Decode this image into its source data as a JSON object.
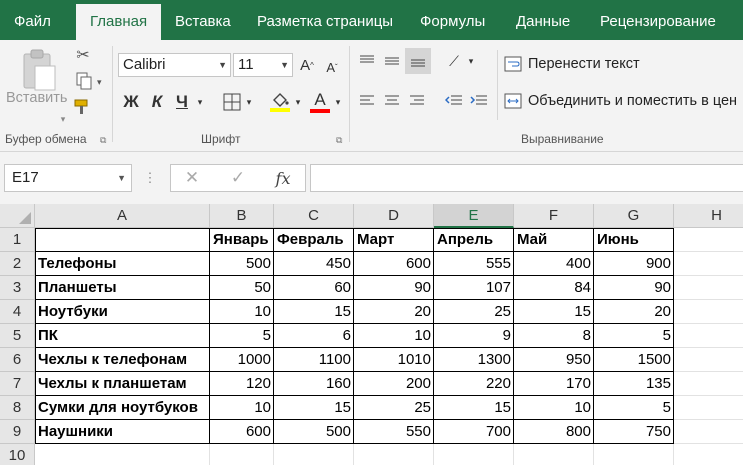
{
  "tabs": [
    "Файл",
    "Главная",
    "Вставка",
    "Разметка страницы",
    "Формулы",
    "Данные",
    "Рецензирование"
  ],
  "ribbon": {
    "paste_label": "Вставить",
    "clipboard_label": "Буфер обмена",
    "font_name": "Calibri",
    "font_size": "11",
    "font_group_label": "Шрифт",
    "bold": "Ж",
    "italic": "К",
    "underline": "Ч",
    "wrap_text": "Перенести текст",
    "merge_center": "Объединить и поместить в цен",
    "alignment_label": "Выравнивание",
    "highlight_color": "#ffff00",
    "font_color": "#ff0000"
  },
  "formula_bar": {
    "name_box": "E17",
    "fx": "fx",
    "formula": ""
  },
  "sheet": {
    "columns": [
      "A",
      "B",
      "C",
      "D",
      "E",
      "F",
      "G",
      "H"
    ],
    "selected_column": "E",
    "rows": [
      "1",
      "2",
      "3",
      "4",
      "5",
      "6",
      "7",
      "8",
      "9",
      "10"
    ],
    "headers": [
      "Январь",
      "Февраль",
      "Март",
      "Апрель",
      "Май",
      "Июнь"
    ],
    "data": [
      {
        "label": "Телефоны",
        "values": [
          "500",
          "450",
          "600",
          "555",
          "400",
          "900"
        ]
      },
      {
        "label": "Планшеты",
        "values": [
          "50",
          "60",
          "90",
          "107",
          "84",
          "90"
        ]
      },
      {
        "label": "Ноутбуки",
        "values": [
          "10",
          "15",
          "20",
          "25",
          "15",
          "20"
        ]
      },
      {
        "label": "ПК",
        "values": [
          "5",
          "6",
          "10",
          "9",
          "8",
          "5"
        ]
      },
      {
        "label": "Чехлы к телефонам",
        "values": [
          "1000",
          "1100",
          "1010",
          "1300",
          "950",
          "1500"
        ]
      },
      {
        "label": "Чехлы к планшетам",
        "values": [
          "120",
          "160",
          "200",
          "220",
          "170",
          "135"
        ]
      },
      {
        "label": "Сумки для ноутбуков",
        "values": [
          "10",
          "15",
          "25",
          "15",
          "10",
          "5"
        ]
      },
      {
        "label": "Наушники",
        "values": [
          "600",
          "500",
          "550",
          "700",
          "800",
          "750"
        ]
      }
    ]
  }
}
